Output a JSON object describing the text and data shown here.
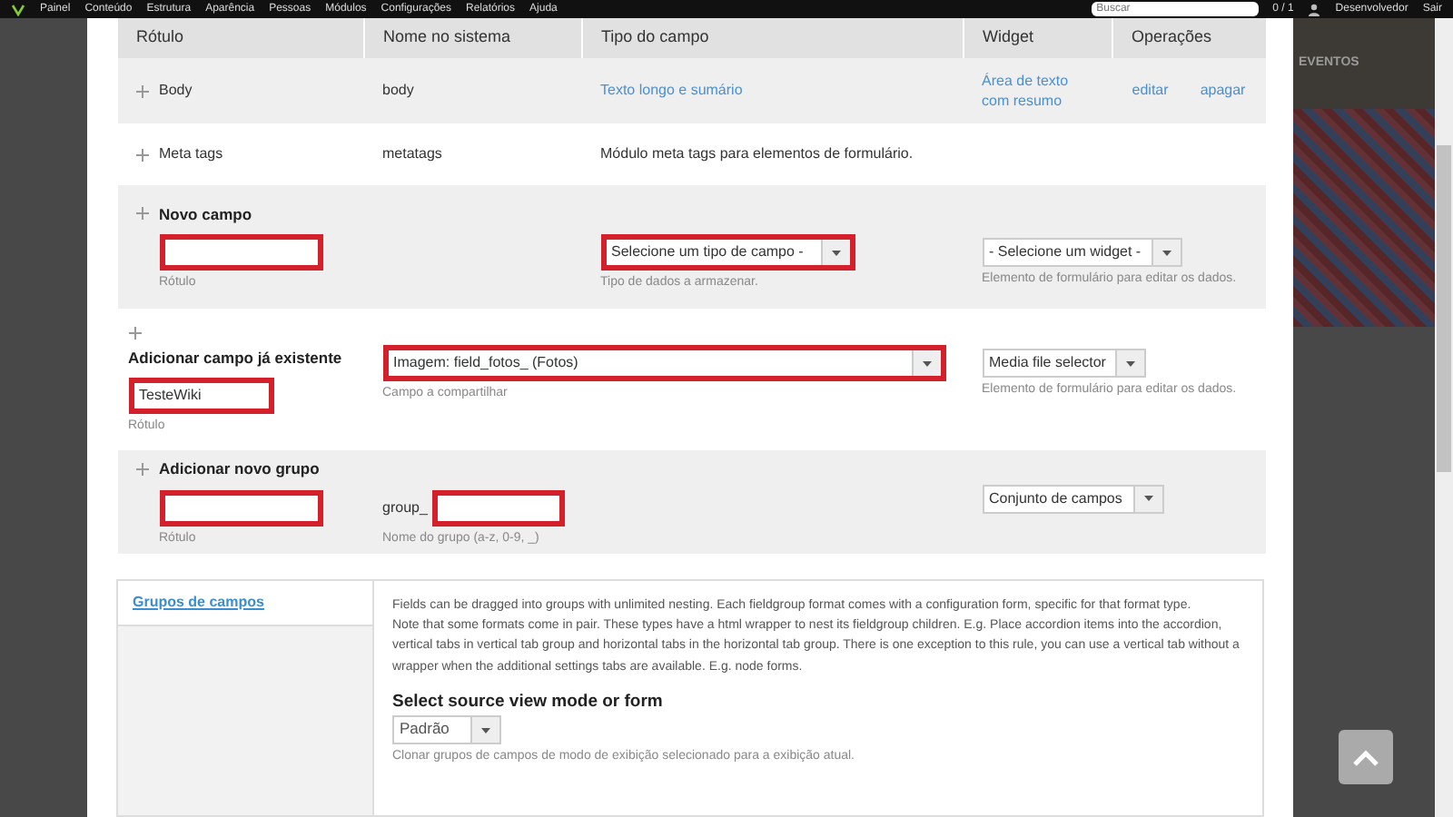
{
  "toolbar": {
    "menu": [
      "Painel",
      "Conteúdo",
      "Estrutura",
      "Aparência",
      "Pessoas",
      "Módulos",
      "Configurações",
      "Relatórios",
      "Ajuda"
    ],
    "search": {
      "placeholder": "Buscar"
    },
    "counter": "0 / 1",
    "user": "Desenvolvedor",
    "logout": "Sair"
  },
  "background": {
    "heading": "EVENTOS"
  },
  "table": {
    "columns": [
      "Rótulo",
      "Nome no sistema",
      "Tipo do campo",
      "Widget",
      "Operações"
    ],
    "rows": [
      {
        "kind": "field",
        "label": "Body",
        "machine_name": "body",
        "type": "Texto longo e sumário",
        "widget": "Área de texto com resumo",
        "operations": [
          "editar",
          "apagar"
        ]
      },
      {
        "kind": "field_note",
        "label": "Meta tags",
        "machine_name": "metatags",
        "description": "Módulo meta tags para elementos de formulário."
      },
      {
        "kind": "new_field",
        "title": "Novo campo",
        "label_input": {
          "hint": "Rótulo",
          "highlighted": true
        },
        "type_select": {
          "value": "Selecione um tipo de campo -",
          "hint": "Tipo de dados a armazenar.",
          "highlighted": true
        },
        "widget_select": {
          "value": "- Selecione um widget -",
          "hint": "Elemento de formulário para editar os dados."
        }
      },
      {
        "kind": "existing_field",
        "title": "Adicionar campo já existente",
        "label_input": {
          "value": "TesteWiki",
          "hint": "Rótulo",
          "highlighted": true
        },
        "type_select": {
          "value": "Imagem: field_fotos_ (Fotos)",
          "hint": "Campo a compartilhar",
          "highlighted": true
        },
        "widget_select": {
          "value": "Media file selector",
          "hint": "Elemento de formulário para editar os dados."
        }
      },
      {
        "kind": "new_group",
        "title": "Adicionar novo grupo",
        "label_input": {
          "hint": "Rótulo",
          "highlighted": true
        },
        "prefix": "group_",
        "name_input": {
          "hint": "Nome do grupo (a-z, 0-9, _)",
          "highlighted": true
        },
        "widget_select": {
          "value": "Conjunto de campos"
        }
      }
    ]
  },
  "fieldgroups": {
    "tab": "Grupos de campos",
    "paragraphs": [
      "Fields can be dragged into groups with unlimited nesting. Each fieldgroup format comes with a configuration form, specific for that format type.",
      "Note that some formats come in pair. These types have a html wrapper to nest its fieldgroup children. E.g. Place accordion items into the accordion, vertical tabs in vertical tab group and horizontal tabs in the horizontal tab group. There is one exception to this rule, you can use a vertical tab without a wrapper when the additional settings tabs are available. E.g. node forms."
    ],
    "heading": "Select source view mode or form",
    "select": {
      "value": "Padrão",
      "hint": "Clonar grupos de campos de modo de exibição selecionado para a exibição atual."
    }
  }
}
